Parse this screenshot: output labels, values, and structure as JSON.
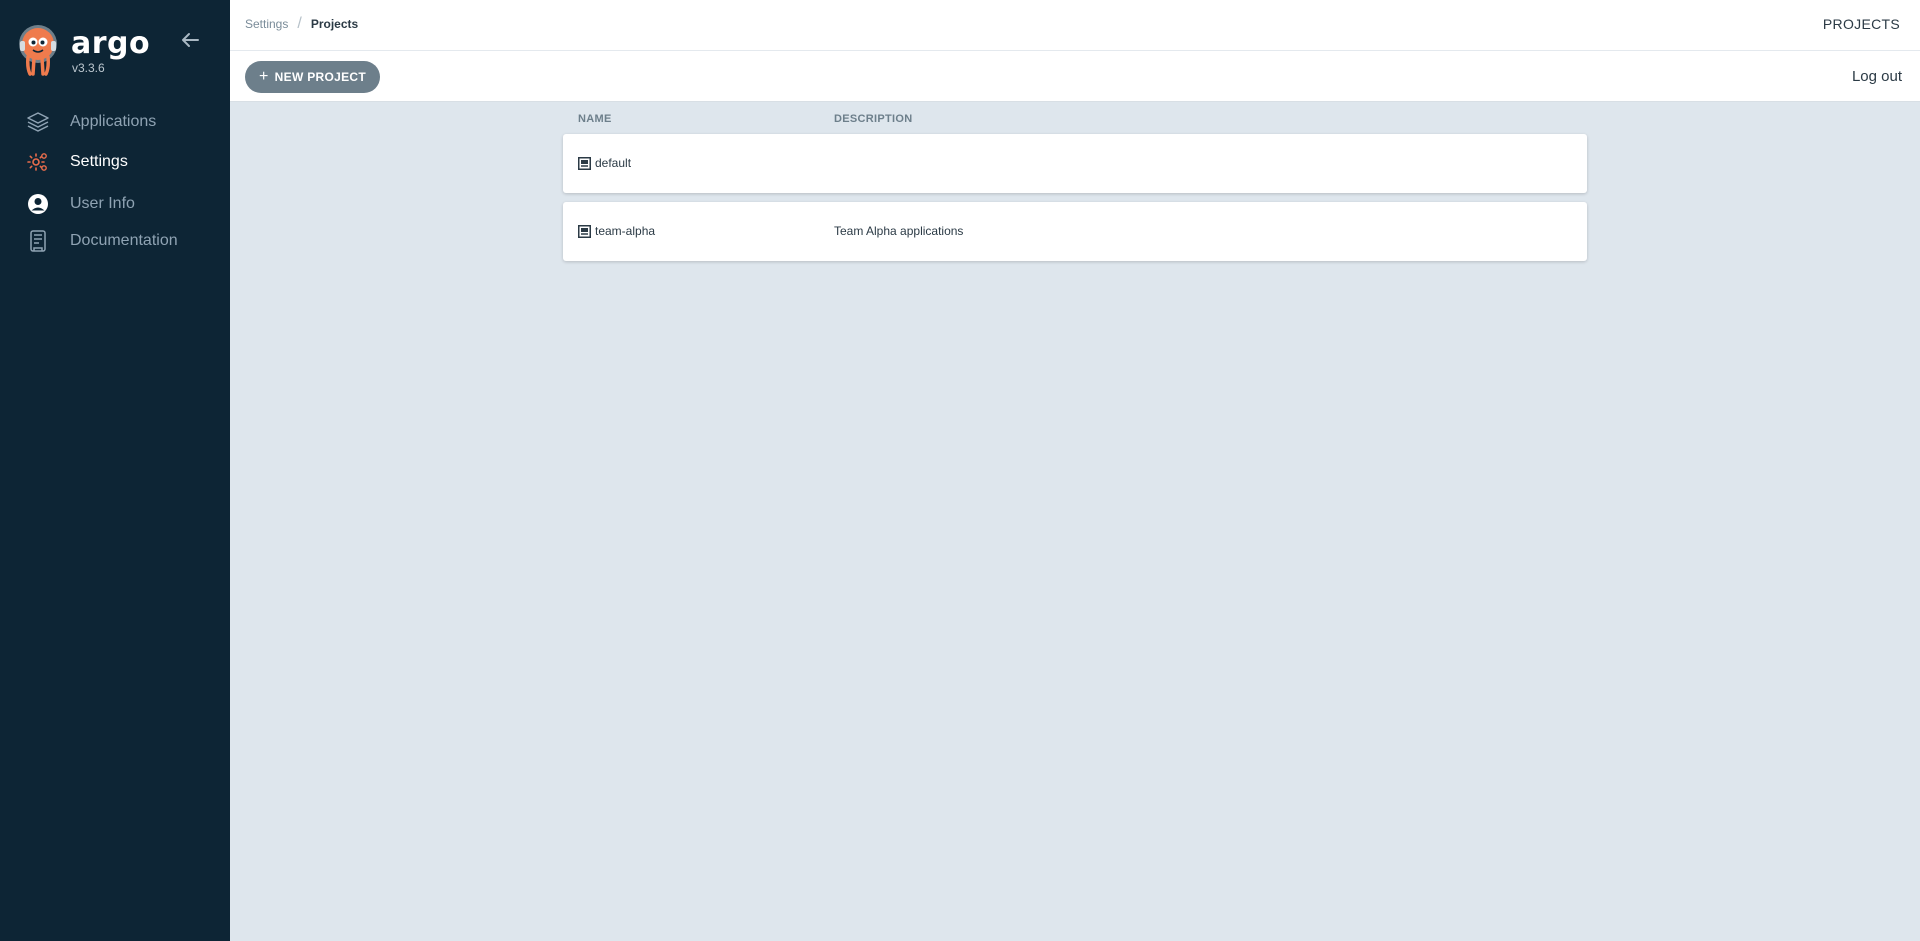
{
  "sidebar": {
    "brand": "argo",
    "version": "v3.3.6",
    "items": [
      {
        "label": "Applications",
        "icon": "layers-icon"
      },
      {
        "label": "Settings",
        "icon": "gear-icon",
        "active": true
      },
      {
        "label": "User Info",
        "icon": "user-circle-icon"
      },
      {
        "label": "Documentation",
        "icon": "book-icon"
      }
    ]
  },
  "header": {
    "breadcrumb": [
      "Settings",
      "Projects"
    ],
    "title": "PROJECTS"
  },
  "toolbar": {
    "new_project_label": "NEW PROJECT",
    "logout_label": "Log out"
  },
  "table": {
    "columns": [
      "NAME",
      "DESCRIPTION"
    ],
    "rows": [
      {
        "name": "default",
        "description": ""
      },
      {
        "name": "team-alpha",
        "description": "Team Alpha applications"
      }
    ]
  },
  "colors": {
    "sidebar_bg": "#0d2535",
    "content_bg": "#dee6ed",
    "accent_orange": "#e96d4c",
    "button_bg": "#6d7f8b"
  }
}
